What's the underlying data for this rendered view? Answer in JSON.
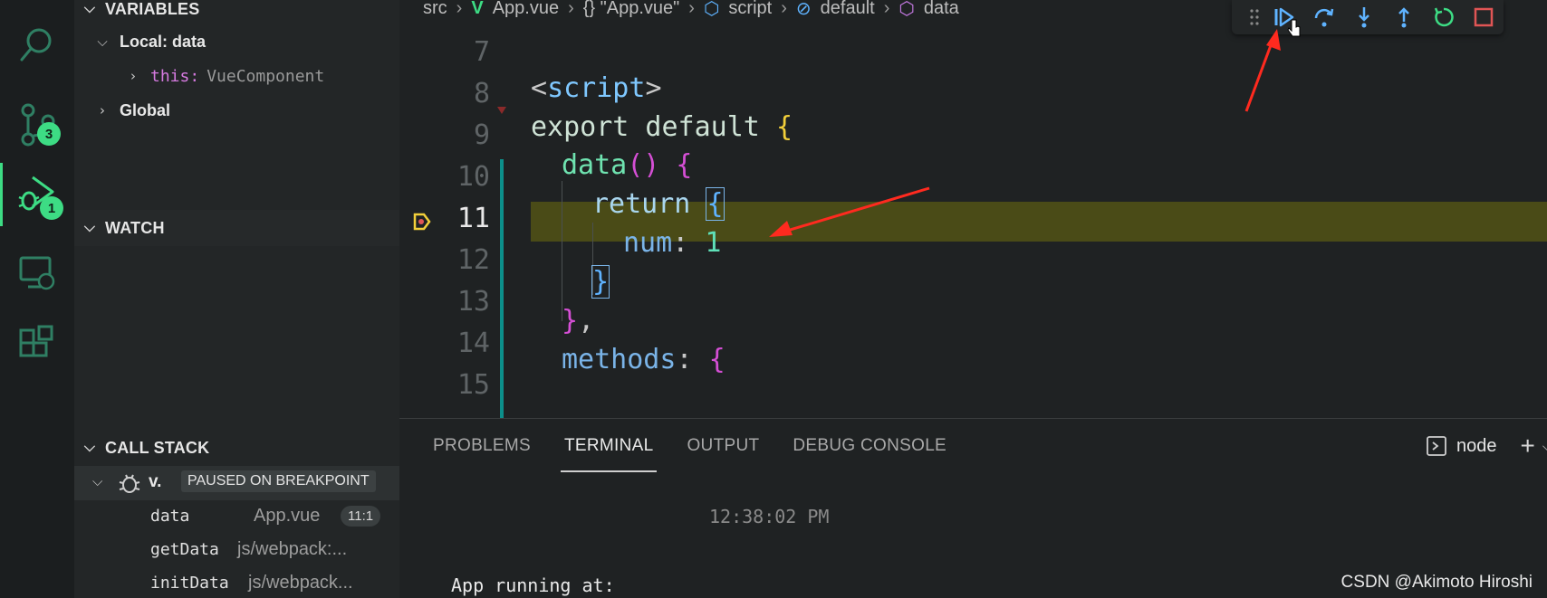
{
  "activity_bar": {
    "scm_badge": "3",
    "debug_badge": "1"
  },
  "sidebar": {
    "variables": {
      "header": "VARIABLES",
      "scope_local": "Local: data",
      "this_key": "this:",
      "this_value": "VueComponent",
      "scope_global": "Global"
    },
    "watch": {
      "header": "WATCH"
    },
    "call_stack": {
      "header": "CALL STACK",
      "session_name": "v.",
      "status": "PAUSED ON BREAKPOINT",
      "frames": [
        {
          "fn": "data",
          "source": "App.vue",
          "position": "11:1"
        },
        {
          "fn": "getData",
          "source": "js/webpack:..."
        },
        {
          "fn": "initData",
          "source": "js/webpack..."
        }
      ]
    }
  },
  "editor": {
    "breadcrumb": [
      "src",
      "App.vue",
      "{} \"App.vue\"",
      "script",
      "default",
      "data"
    ],
    "line_numbers": [
      "7",
      "8",
      "9",
      "10",
      "11",
      "12",
      "13",
      "14",
      "15"
    ],
    "current_line": "11",
    "code": {
      "l8_tag_open": "<",
      "l8_tag_name": "script",
      "l8_tag_close": ">",
      "l9_kw": "export default ",
      "l9_brace": "{",
      "l10_fn": "data",
      "l10_parens": "()",
      "l10_brace": " {",
      "l11_kw": "return ",
      "l11_brace": "{",
      "l12_prop": "num",
      "l12_colon": ": ",
      "l12_value": "1",
      "l13_brace": "}",
      "l14_brace": "}",
      "l14_comma": ",",
      "l15_prop": "methods",
      "l15_colon": ": ",
      "l15_brace": "{"
    }
  },
  "panel": {
    "tabs": [
      "PROBLEMS",
      "TERMINAL",
      "OUTPUT",
      "DEBUG CONSOLE"
    ],
    "active_tab": "TERMINAL",
    "terminal_time": "12:38:02 PM",
    "terminal_line": "App running at:",
    "shell": "node"
  },
  "watermark": "CSDN @Akimoto Hiroshi",
  "colors": {
    "accent_green": "#3ddc84",
    "highlight_line": "#4a4b17",
    "stop_red": "#e05555",
    "continue_blue": "#5fb3ff"
  }
}
